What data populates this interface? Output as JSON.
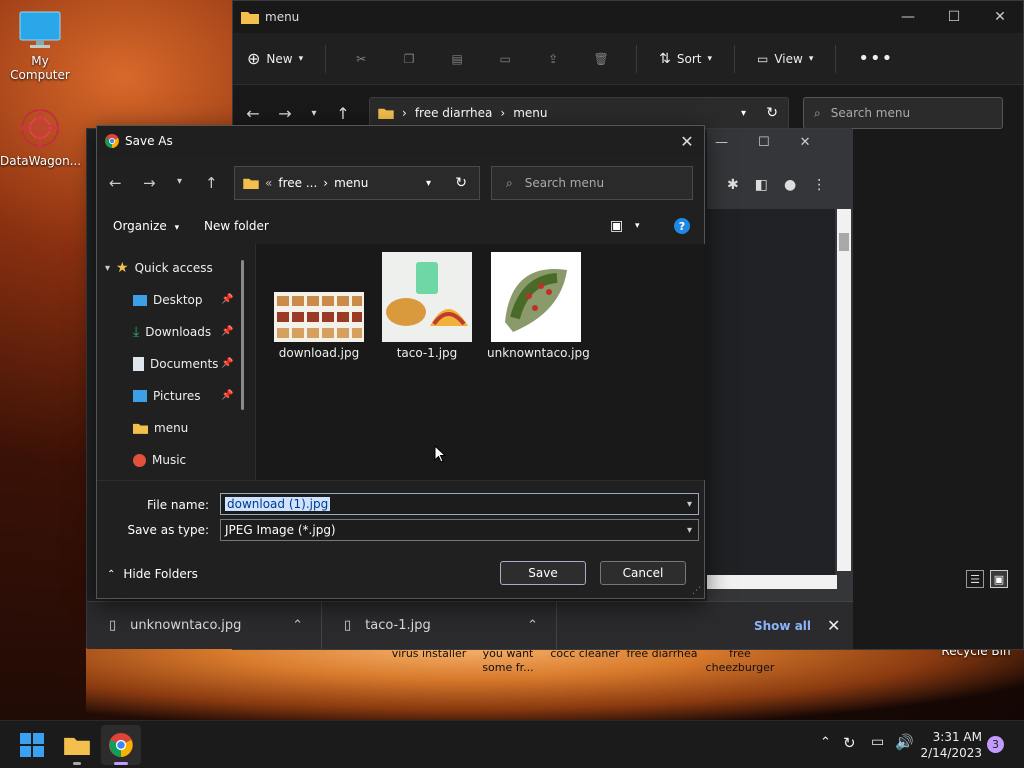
{
  "desktop": {
    "icons": [
      {
        "label": "My Computer"
      },
      {
        "label": "DataWagon..."
      },
      {
        "label": "Recycle Bin"
      }
    ],
    "labels": [
      "virus installer",
      "you want some fr...",
      "cocc cleaner",
      "free diarrhea",
      "free cheezburger"
    ]
  },
  "explorer": {
    "title": "menu",
    "toolbar": {
      "new": "New",
      "sort": "Sort",
      "view": "View"
    },
    "breadcrumb": [
      "free diarrhea",
      "menu"
    ],
    "search_placeholder": "Search menu"
  },
  "chrome": {
    "downloads": [
      {
        "name": "unknowntaco.jpg"
      },
      {
        "name": "taco-1.jpg"
      }
    ],
    "show_all": "Show all"
  },
  "dialog": {
    "title": "Save As",
    "breadcrumb": [
      "free ...",
      "menu"
    ],
    "breadcrumb_prefix": "«",
    "search_placeholder": "Search menu",
    "organize": "Organize",
    "new_folder": "New folder",
    "tree": [
      {
        "label": "Quick access"
      },
      {
        "label": "Desktop"
      },
      {
        "label": "Downloads"
      },
      {
        "label": "Documents"
      },
      {
        "label": "Pictures"
      },
      {
        "label": "menu"
      },
      {
        "label": "Music"
      }
    ],
    "files": [
      {
        "name": "download.jpg"
      },
      {
        "name": "taco-1.jpg"
      },
      {
        "name": "unknowntaco.jpg"
      }
    ],
    "file_name_label": "File name:",
    "file_name_value": "download (1).jpg",
    "save_type_label": "Save as type:",
    "save_type_value": "JPEG Image (*.jpg)",
    "hide_folders": "Hide Folders",
    "save": "Save",
    "cancel": "Cancel"
  },
  "taskbar": {
    "time": "3:31 AM",
    "date": "2/14/2023",
    "notifications": "3"
  },
  "colors": {
    "accent": "#0078d4",
    "folder": "#f3c04d",
    "selection": "#cfe3ff"
  }
}
